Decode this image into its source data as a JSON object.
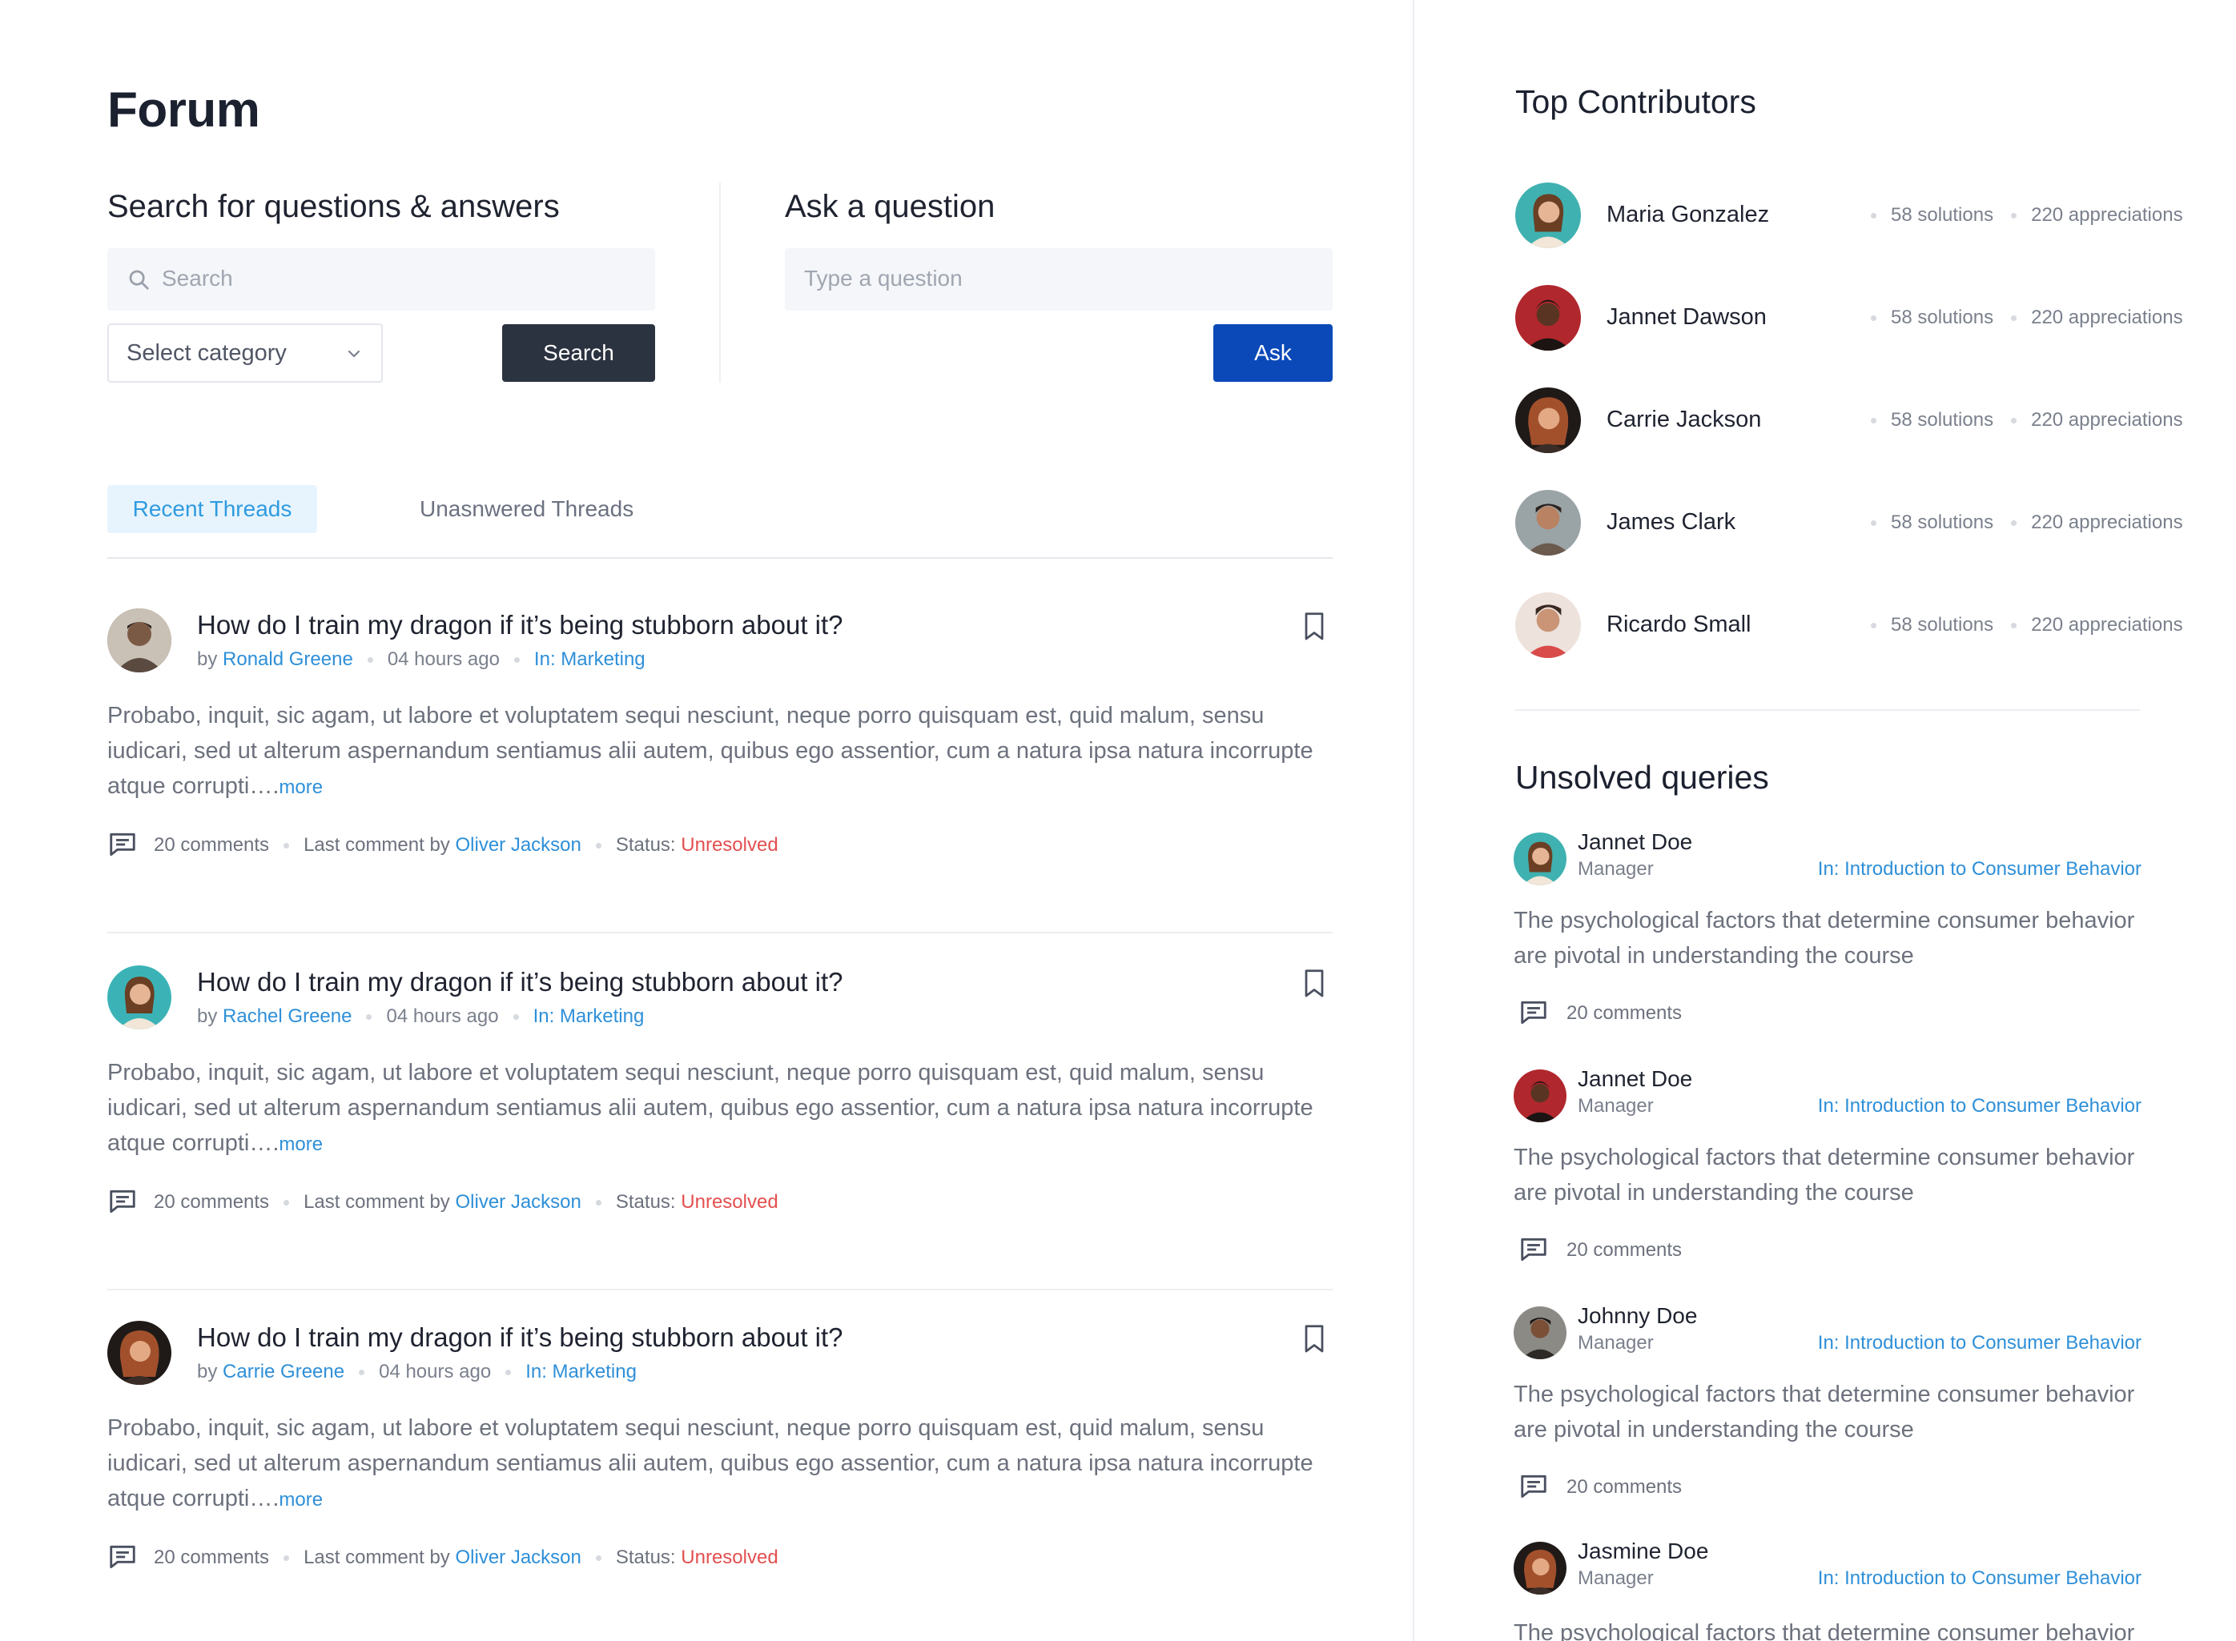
{
  "page": {
    "title": "Forum"
  },
  "search": {
    "heading": "Search for questions & answers",
    "placeholder": "Search",
    "category_value": "Select category",
    "button": "Search"
  },
  "ask": {
    "heading": "Ask a question",
    "placeholder": "Type a question",
    "button": "Ask"
  },
  "tabs": [
    {
      "label": "Recent Threads",
      "active": true
    },
    {
      "label": "Unasnwered Threads",
      "active": false
    }
  ],
  "threads": [
    {
      "title": "How do I train my dragon if it’s being stubborn about it?",
      "by_prefix": "by",
      "author": "Ronald Greene",
      "time": "04 hours ago",
      "category": "In: Marketing",
      "body": "Probabo, inquit, sic agam, ut labore et voluptatem sequi nesciunt, neque porro quisquam est, quid malum, sensu iudicari, sed ut alterum aspernandum sentiamus alii autem, quibus ego assentior, cum a natura ipsa natura incorrupte atque corrupti….",
      "more": "more",
      "comments": "20 comments",
      "last_prefix": "Last comment by",
      "last_by": "Oliver Jackson",
      "status_prefix": "Status:",
      "status": "Unresolved",
      "avatar_color": "#7b5a45"
    },
    {
      "title": "How do I train my dragon if it’s being stubborn about it?",
      "by_prefix": "by",
      "author": "Rachel Greene",
      "time": "04 hours ago",
      "category": "In: Marketing",
      "body": "Probabo, inquit, sic agam, ut labore et voluptatem sequi nesciunt, neque porro quisquam est, quid malum, sensu iudicari, sed ut alterum aspernandum sentiamus alii autem, quibus ego assentior, cum a natura ipsa natura incorrupte atque corrupti….",
      "more": "more",
      "comments": "20 comments",
      "last_prefix": "Last comment by",
      "last_by": "Oliver Jackson",
      "status_prefix": "Status:",
      "status": "Unresolved",
      "avatar_color": "#3bb3b6"
    },
    {
      "title": "How do I train my dragon if it’s being stubborn about it?",
      "by_prefix": "by",
      "author": "Carrie Greene",
      "time": "04 hours ago",
      "category": "In: Marketing",
      "body": "Probabo, inquit, sic agam, ut labore et voluptatem sequi nesciunt, neque porro quisquam est, quid malum, sensu iudicari, sed ut alterum aspernandum sentiamus alii autem, quibus ego assentior, cum a natura ipsa natura incorrupte atque corrupti….",
      "more": "more",
      "comments": "20 comments",
      "last_prefix": "Last comment by",
      "last_by": "Oliver Jackson",
      "status_prefix": "Status:",
      "status": "Unresolved",
      "avatar_color": "#2b2320"
    }
  ],
  "contributors": {
    "heading": "Top Contributors",
    "items": [
      {
        "name": "Maria Gonzalez",
        "solutions": "58 solutions",
        "appreciations": "220 appreciations",
        "avatar_color": "#3fb1b0"
      },
      {
        "name": "Jannet Dawson",
        "solutions": "58 solutions",
        "appreciations": "220 appreciations",
        "avatar_color": "#b0272d"
      },
      {
        "name": "Carrie Jackson",
        "solutions": "58 solutions",
        "appreciations": "220 appreciations",
        "avatar_color": "#2a221f"
      },
      {
        "name": "James Clark",
        "solutions": "58 solutions",
        "appreciations": "220 appreciations",
        "avatar_color": "#9aa3a6"
      },
      {
        "name": "Ricardo Small",
        "solutions": "58 solutions",
        "appreciations": "220 appreciations",
        "avatar_color": "#e8d8d2"
      }
    ]
  },
  "unsolved": {
    "heading": "Unsolved queries",
    "items": [
      {
        "name": "Jannet Doe",
        "role": "Manager",
        "course": "In: Introduction to Consumer Behavior",
        "text": "The psychological factors that determine consumer behavior are pivotal in understanding the course",
        "comments": "20 comments",
        "avatar_color": "#3fb1b0"
      },
      {
        "name": "Jannet Doe",
        "role": "Manager",
        "course": "In: Introduction to Consumer Behavior",
        "text": "The psychological factors that determine consumer behavior are pivotal in understanding the course",
        "comments": "20 comments",
        "avatar_color": "#b0272d"
      },
      {
        "name": "Johnny Doe",
        "role": "Manager",
        "course": "In: Introduction to Consumer Behavior",
        "text": "The psychological factors that determine consumer behavior are pivotal in understanding the course",
        "comments": "20 comments",
        "avatar_color": "#7f6a5c"
      },
      {
        "name": "Jasmine Doe",
        "role": "Manager",
        "course": "In: Introduction to Consumer Behavior",
        "text": "The psychological factors that determine consumer behavior",
        "comments": "",
        "avatar_color": "#2a221f"
      }
    ]
  }
}
